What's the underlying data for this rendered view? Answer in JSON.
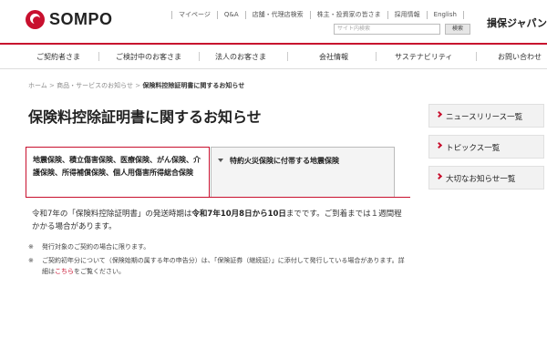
{
  "header": {
    "logo_text": "SOMPO",
    "brand_jp": "損保ジャパン",
    "util_links": [
      "マイページ",
      "Q&A",
      "店舗・代理店検索",
      "株主・投資家の皆さま",
      "採用情報",
      "English"
    ],
    "search": {
      "placeholder": "サイト内検索",
      "button_label": "検索"
    },
    "accent_color": "#c8102e"
  },
  "global_nav": [
    "ご契約者さま",
    "ご検討中のお客さま",
    "法人のお客さま",
    "会社情報",
    "サステナビリティ",
    "お問い合わせ"
  ],
  "breadcrumb": {
    "items": [
      "ホーム",
      "商品・サービスのお知らせ"
    ],
    "separator": ">",
    "current": "保険料控除証明書に関するお知らせ"
  },
  "page_title": "保険料控除証明書に関するお知らせ",
  "tabs": [
    {
      "label": "地震保険、積立傷害保険、医療保険、がん保険、介護保険、所得補償保険、個人用傷害所得総合保険",
      "active": true
    },
    {
      "label": "特約火災保険に付帯する地震保険",
      "active": false
    }
  ],
  "notice": {
    "text_before": "令和7年の「保険料控除証明書」の発送時期は",
    "text_bold": "令和7年10月8日から10日",
    "text_after": "までです。ご到着までは１週間程かかる場合があります。"
  },
  "notes": [
    {
      "mark": "※",
      "text": "発行対象のご契約の場合に限ります。"
    },
    {
      "mark": "※",
      "text_before": "ご契約初年分について（保険始期の属する年の申告分）は、「保険証券（継続証）」に添付して発行している場合があります。詳細は",
      "link": "こちら",
      "text_after": "をご覧ください。"
    }
  ],
  "sidebar": [
    "ニュースリリース一覧",
    "トピックス一覧",
    "大切なお知らせ一覧"
  ]
}
